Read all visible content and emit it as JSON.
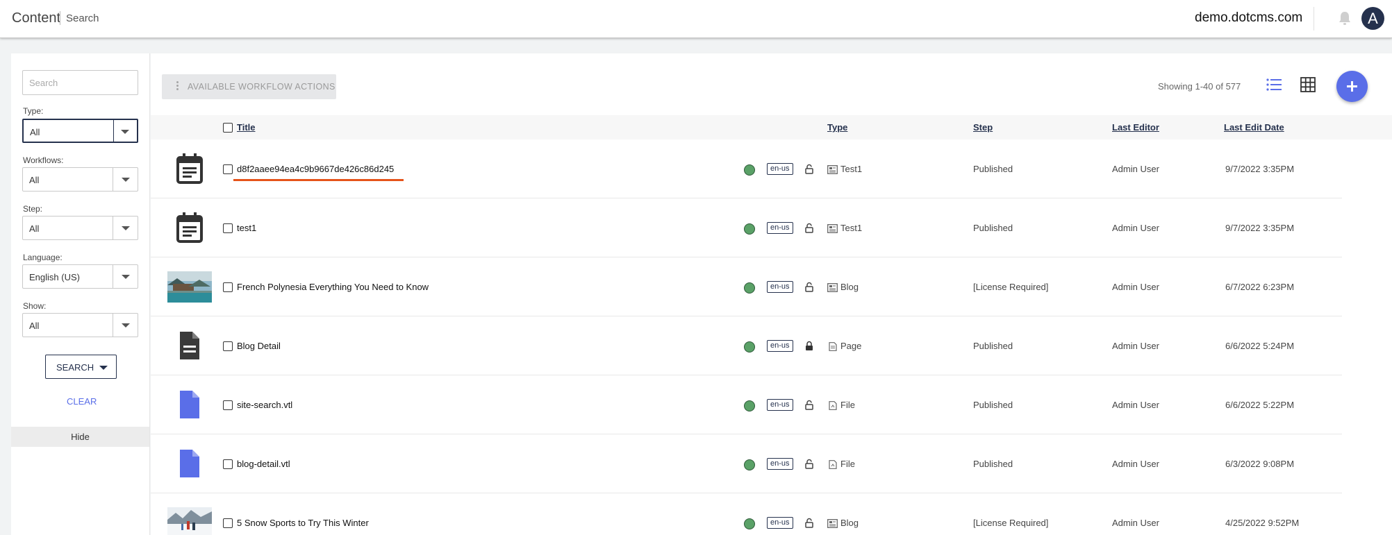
{
  "header": {
    "title": "Content",
    "page": "Search",
    "site": "demo.dotcms.com",
    "avatar_letter": "A"
  },
  "filters": {
    "search_placeholder": "Search",
    "type": {
      "label": "Type:",
      "value": "All"
    },
    "workflows": {
      "label": "Workflows:",
      "value": "All"
    },
    "step": {
      "label": "Step:",
      "value": "All"
    },
    "language": {
      "label": "Language:",
      "value": "English (US)"
    },
    "show": {
      "label": "Show:",
      "value": "All"
    },
    "search_button": "SEARCH",
    "clear_button": "CLEAR",
    "hide_label": "Hide"
  },
  "toolbar": {
    "workflow_actions": "AVAILABLE WORKFLOW ACTIONS",
    "showing": "Showing 1-40 of 577"
  },
  "table": {
    "columns": {
      "title": "Title",
      "type": "Type",
      "step": "Step",
      "last_editor": "Last Editor",
      "last_edit_date": "Last Edit Date"
    },
    "rows": [
      {
        "thumb": "calendar-icon",
        "title": "d8f2aaee94ea4c9b9667de426c86d245",
        "lang": "en-us",
        "type": "Test1",
        "type_icon": "content-icon",
        "step": "Published",
        "editor": "Admin User",
        "date": "9/7/2022 3:35PM"
      },
      {
        "thumb": "calendar-icon",
        "title": "test1",
        "lang": "en-us",
        "type": "Test1",
        "type_icon": "content-icon",
        "step": "Published",
        "editor": "Admin User",
        "date": "9/7/2022 3:35PM"
      },
      {
        "thumb": "photo-thumbnail",
        "title": "French Polynesia Everything You Need to Know",
        "lang": "en-us",
        "type": "Blog",
        "type_icon": "content-icon",
        "step": "[License Required]",
        "editor": "Admin User",
        "date": "6/7/2022 6:23PM"
      },
      {
        "thumb": "document-icon",
        "title": "Blog Detail",
        "lang": "en-us",
        "type": "Page",
        "type_icon": "page-icon",
        "step": "Published",
        "editor": "Admin User",
        "date": "6/6/2022 5:24PM"
      },
      {
        "thumb": "file-icon",
        "title": "site-search.vtl",
        "lang": "en-us",
        "type": "File",
        "type_icon": "file-icon",
        "step": "Published",
        "editor": "Admin User",
        "date": "6/6/2022 5:22PM"
      },
      {
        "thumb": "file-icon",
        "title": "blog-detail.vtl",
        "lang": "en-us",
        "type": "File",
        "type_icon": "file-icon",
        "step": "Published",
        "editor": "Admin User",
        "date": "6/3/2022 9:08PM"
      },
      {
        "thumb": "photo-thumbnail",
        "title": "5 Snow Sports to Try This Winter",
        "lang": "en-us",
        "type": "Blog",
        "type_icon": "content-icon",
        "step": "[License Required]",
        "editor": "Admin User",
        "date": "4/25/2022 9:52PM"
      }
    ]
  },
  "colors": {
    "accent": "#5a6ee8",
    "primary": "#25314d",
    "published_status": "#5aa167",
    "highlight": "#e5531a"
  }
}
